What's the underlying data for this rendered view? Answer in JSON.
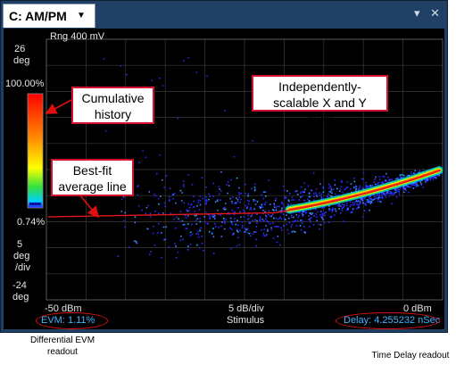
{
  "window": {
    "tab_label": "C: AM/PM",
    "caret_glyph": "▼",
    "pin_glyph": "▾",
    "close_glyph": "✕"
  },
  "plot": {
    "range_label": "Rng 400 mV",
    "y_top_value": "26",
    "y_top_unit": "deg",
    "scale_value": "5",
    "scale_unit": "deg",
    "scale_per": "/div",
    "y_bottom_value": "-24",
    "y_bottom_unit": "deg",
    "x_left": "-50 dBm",
    "x_mid": "5 dB/div",
    "x_right": "0 dBm",
    "x_title": "Stimulus",
    "colorbar_max": "100.00%",
    "colorbar_min": "0.74%"
  },
  "readouts": {
    "evm": "EVM: 1.11%",
    "delay": "Delay: 4.255232 nSec"
  },
  "callouts": {
    "cumulative": "Cumulative history",
    "bestfit": "Best-fit average line",
    "axes": "Independently-scalable X and Y axes"
  },
  "captions": {
    "evm": "Differential EVM readout",
    "delay": "Time Delay readout"
  },
  "colors": {
    "window_frame": "#1f3f64",
    "plot_bg": "#000000",
    "grid": "#3a3a3a",
    "fit_line": "#e01818",
    "readout": "#3fb4ff",
    "callout_border": "#d2122e"
  }
}
